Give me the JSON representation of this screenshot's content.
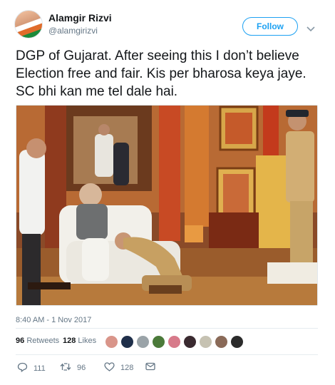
{
  "header": {
    "display_name": "Alamgir Rizvi",
    "handle": "@alamgirizvi",
    "follow_label": "Follow"
  },
  "tweet": {
    "text": "DGP of Gujarat. After seeing this I don’t believe Election free and fair. Kis per bharosa keya jaye. SC bhi kan me tel dale hai.",
    "timestamp": "8:40 AM - 1 Nov 2017"
  },
  "stats": {
    "retweets_count": "96",
    "retweets_label": "Retweets",
    "likes_count": "128",
    "likes_label": "Likes"
  },
  "actions": {
    "reply_count": "111",
    "retweet_count": "96",
    "like_count": "128"
  },
  "icons": {
    "reply": "reply-icon",
    "retweet": "retweet-icon",
    "like": "heart-icon",
    "message": "message-icon",
    "caret": "chevron-down-icon"
  },
  "colors": {
    "accent": "#1da1f2",
    "text": "#14171a",
    "muted": "#657786"
  }
}
